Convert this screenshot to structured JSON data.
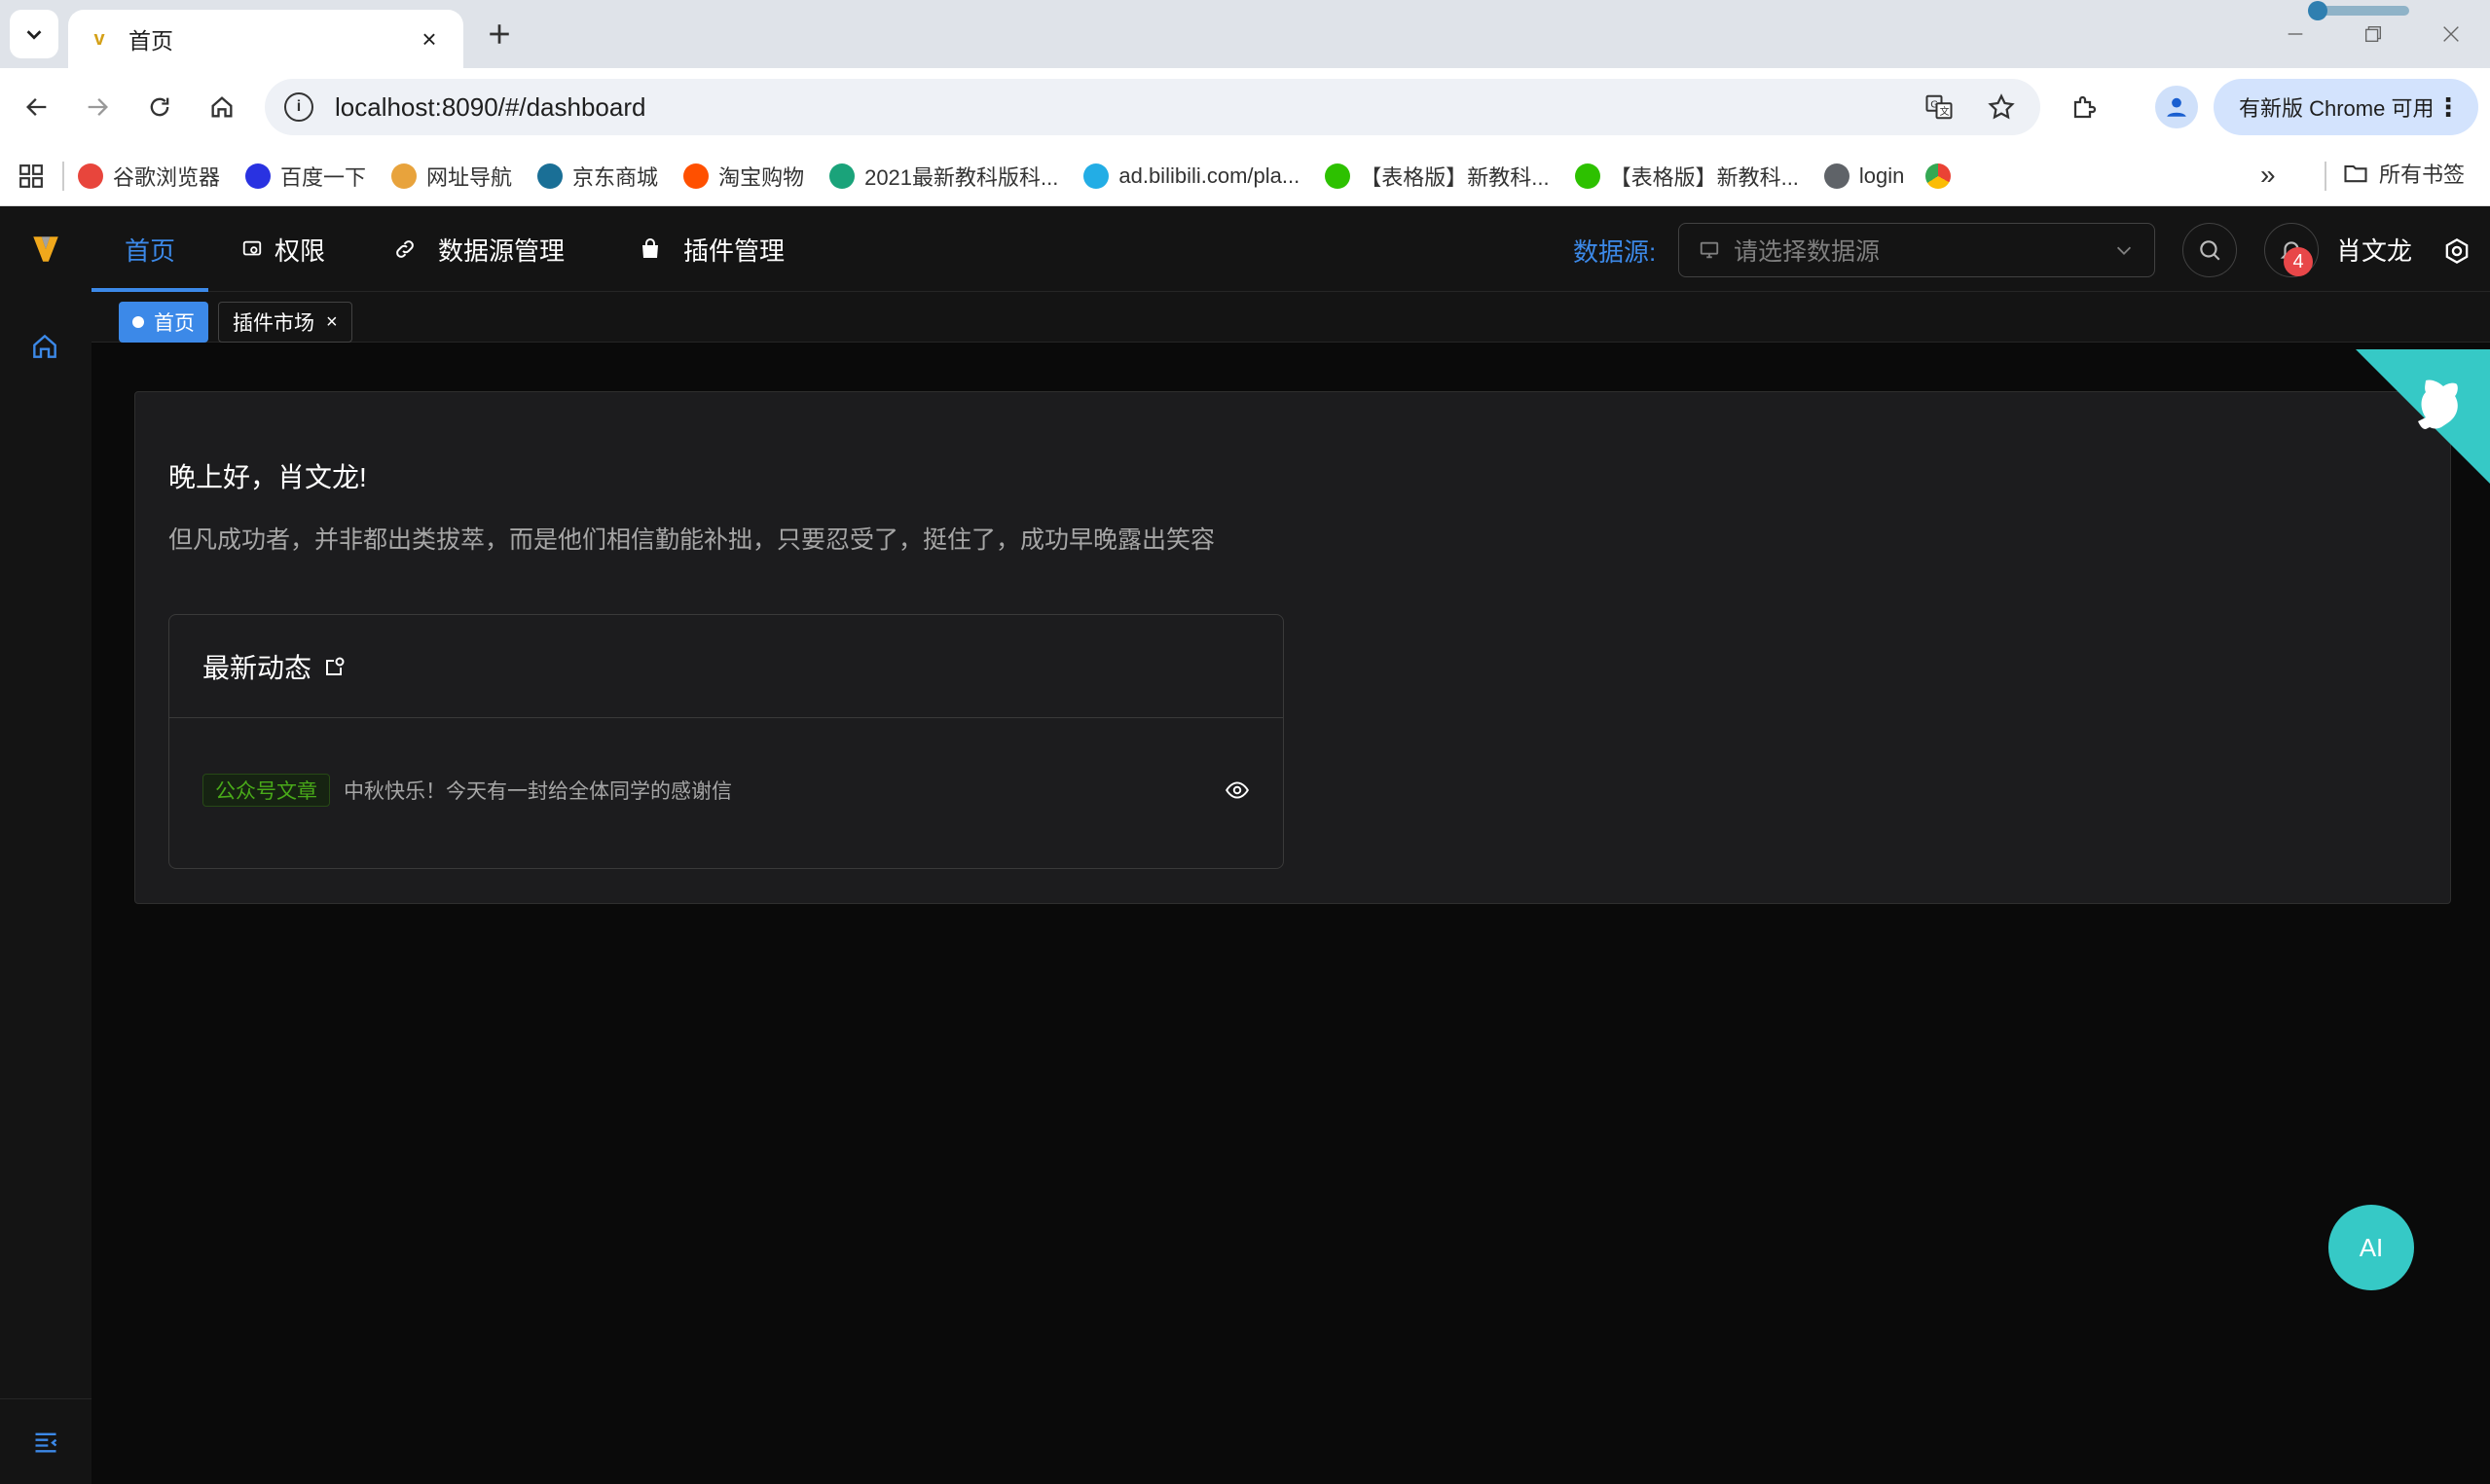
{
  "browser": {
    "tab_title": "首页",
    "tab_favicon": "v",
    "url": "localhost:8090/#/dashboard",
    "update_label": "有新版 Chrome 可用",
    "bookmarks": [
      {
        "label": "谷歌浏览器",
        "icon": "chrome-icon",
        "color": "#e8453c"
      },
      {
        "label": "百度一下",
        "icon": "baidu-paw-icon",
        "color": "#2932e1"
      },
      {
        "label": "网址导航",
        "icon": "hao-icon",
        "color": "#e8a33c"
      },
      {
        "label": "京东商城",
        "icon": "jd-icon",
        "color": "#1a6f96"
      },
      {
        "label": "淘宝购物",
        "icon": "taobao-icon",
        "color": "#ff5000"
      },
      {
        "label": "2021最新教科版科...",
        "icon": "book-icon",
        "color": "#1aa37a"
      },
      {
        "label": "ad.bilibili.com/pla...",
        "icon": "bilibili-icon",
        "color": "#23ade5"
      },
      {
        "label": "【表格版】新教科...",
        "icon": "wechat-icon",
        "color": "#2dc100"
      },
      {
        "label": "【表格版】新教科...",
        "icon": "wechat-icon",
        "color": "#2dc100"
      },
      {
        "label": "login",
        "icon": "globe-icon",
        "color": "#5f6368"
      }
    ],
    "bookmarks_more": "»",
    "all_bookmarks": "所有书签"
  },
  "app": {
    "menu": {
      "home": "首页",
      "permission": "权限",
      "datasource": "数据源管理",
      "plugins": "插件管理"
    },
    "datasource_label": "数据源:",
    "datasource_placeholder": "请选择数据源",
    "notification_count": "4",
    "user_name": "肖文龙",
    "tags": {
      "home": "首页",
      "market": "插件市场"
    },
    "greeting": "晚上好，肖文龙!",
    "motto": "但凡成功者，并非都出类拔萃，而是他们相信勤能补拙，只要忍受了，挺住了，成功早晚露出笑容",
    "news": {
      "title": "最新动态",
      "items": [
        {
          "tag": "公众号文章",
          "title": "中秋快乐！今天有一封给全体同学的感谢信"
        }
      ]
    },
    "ai_button": "AI"
  },
  "colors": {
    "accent": "#3c89e8",
    "teal": "#36c9c6",
    "badge": "#e84749",
    "success": "#49aa19"
  }
}
